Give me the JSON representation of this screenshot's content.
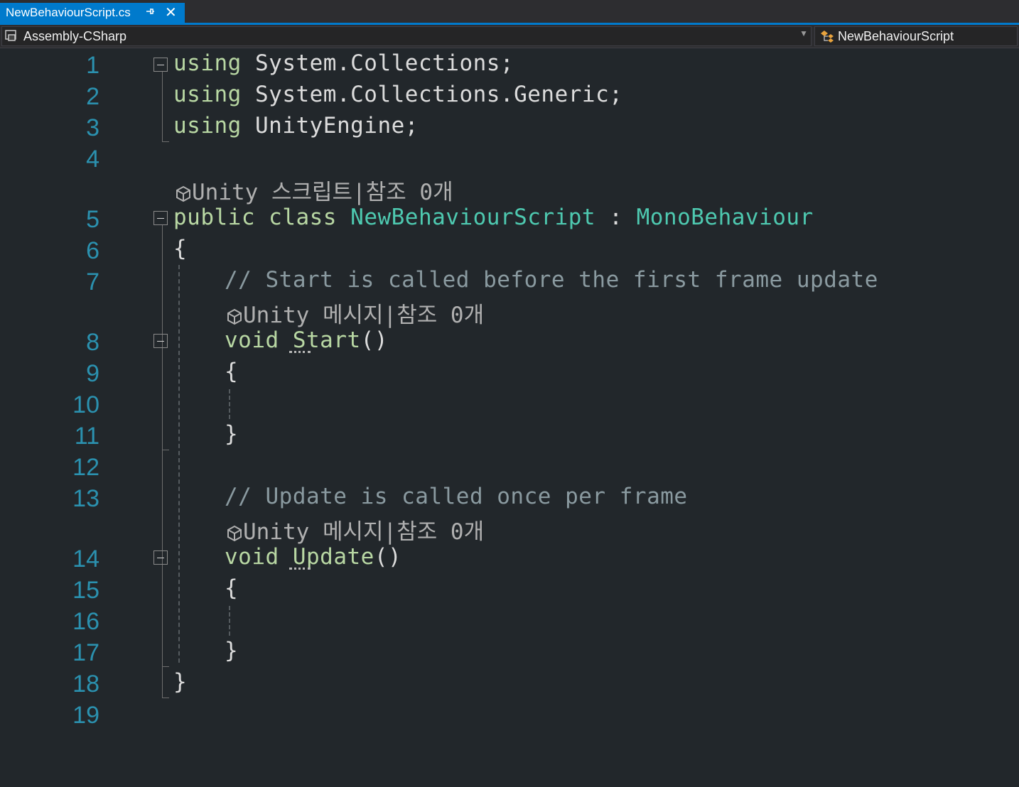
{
  "tab": {
    "title": "NewBehaviourScript.cs",
    "pin_icon": "pin-icon",
    "close_icon": "close-icon"
  },
  "navbar": {
    "project": "Assembly-CSharp",
    "class": "NewBehaviourScript"
  },
  "line_numbers": [
    "1",
    "2",
    "3",
    "4",
    "5",
    "6",
    "7",
    "8",
    "9",
    "10",
    "11",
    "12",
    "13",
    "14",
    "15",
    "16",
    "17",
    "18",
    "19"
  ],
  "code": {
    "l1_kw": "using",
    "l1_rest": " System.Collections;",
    "l2_kw": "using",
    "l2_rest": " System.Collections.Generic;",
    "l3_kw": "using",
    "l3_rest": " UnityEngine;",
    "lens1": "Unity 스크립트|참조 0개",
    "l5_kw1": "public",
    "l5_kw2": "class",
    "l5_type": "NewBehaviourScript",
    "l5_colon": " : ",
    "l5_base": "MonoBehaviour",
    "l6": "{",
    "l7": "// Start is called before the first frame update",
    "lens2": "Unity 메시지|참조 0개",
    "l8_kw": "void",
    "l8_fn": "Start",
    "l8_paren": "()",
    "l9": "{",
    "l11": "}",
    "l13": "// Update is called once per frame",
    "lens3": "Unity 메시지|참조 0개",
    "l14_kw": "void",
    "l14_fn": "Update",
    "l14_paren": "()",
    "l15": "{",
    "l17": "}",
    "l18": "}"
  },
  "colors": {
    "keyword": "#b8d7a3",
    "type": "#4ec9b0",
    "comment": "#8a9aa0",
    "line_number": "#2b91af",
    "accent": "#007acc"
  }
}
